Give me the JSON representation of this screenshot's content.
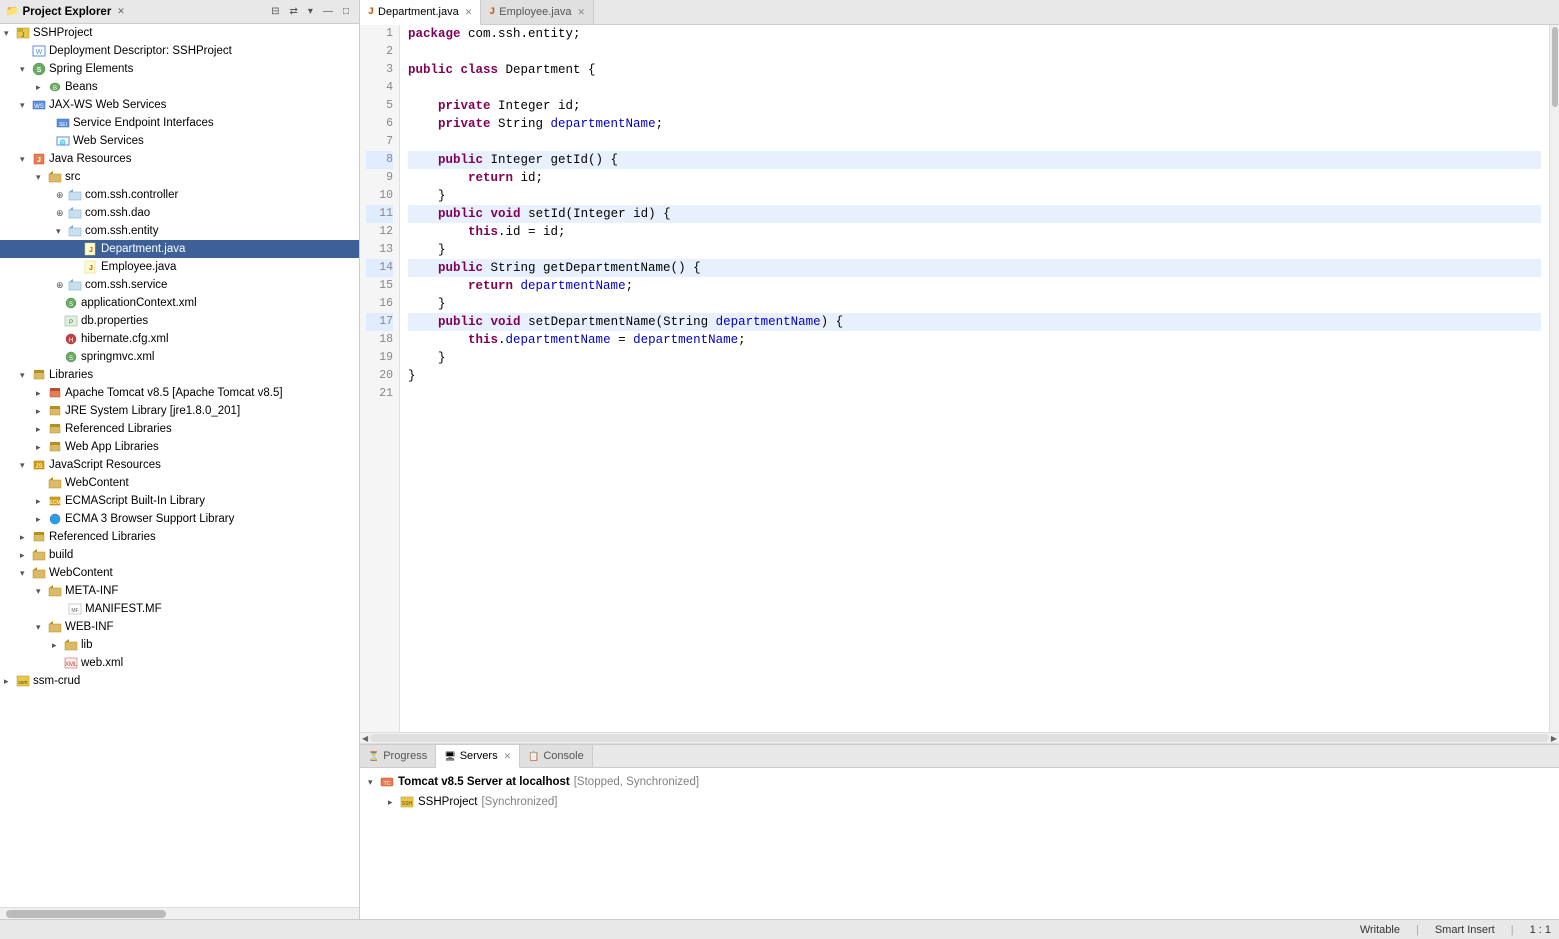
{
  "projectExplorer": {
    "title": "Project Explorer",
    "tree": [
      {
        "id": "sshproject",
        "label": "SSHProject",
        "indent": 0,
        "type": "project",
        "open": true,
        "arrow": "open"
      },
      {
        "id": "deploy-desc",
        "label": "Deployment Descriptor: SSHProject",
        "indent": 1,
        "type": "descriptor",
        "arrow": "leaf"
      },
      {
        "id": "spring-elements",
        "label": "Spring Elements",
        "indent": 1,
        "type": "spring",
        "open": true,
        "arrow": "open"
      },
      {
        "id": "beans",
        "label": "Beans",
        "indent": 2,
        "type": "beans",
        "arrow": "closed"
      },
      {
        "id": "jax-ws",
        "label": "JAX-WS Web Services",
        "indent": 1,
        "type": "webservices",
        "open": true,
        "arrow": "open"
      },
      {
        "id": "sei",
        "label": "Service Endpoint Interfaces",
        "indent": 2,
        "type": "interface",
        "arrow": "leaf"
      },
      {
        "id": "web-services",
        "label": "Web Services",
        "indent": 2,
        "type": "web",
        "arrow": "leaf"
      },
      {
        "id": "java-resources",
        "label": "Java Resources",
        "indent": 1,
        "type": "java",
        "open": true,
        "arrow": "open"
      },
      {
        "id": "src",
        "label": "src",
        "indent": 2,
        "type": "folder-src",
        "open": true,
        "arrow": "open"
      },
      {
        "id": "pkg-controller",
        "label": "com.ssh.controller",
        "indent": 3,
        "type": "package",
        "arrow": "closed"
      },
      {
        "id": "pkg-dao",
        "label": "com.ssh.dao",
        "indent": 3,
        "type": "package",
        "arrow": "closed"
      },
      {
        "id": "pkg-entity",
        "label": "com.ssh.entity",
        "indent": 3,
        "type": "package",
        "open": true,
        "arrow": "open"
      },
      {
        "id": "dept-java",
        "label": "Department.java",
        "indent": 4,
        "type": "java-file",
        "selected": true,
        "arrow": "leaf"
      },
      {
        "id": "emp-java",
        "label": "Employee.java",
        "indent": 4,
        "type": "java-file",
        "arrow": "leaf"
      },
      {
        "id": "pkg-service",
        "label": "com.ssh.service",
        "indent": 3,
        "type": "package",
        "arrow": "closed"
      },
      {
        "id": "app-context",
        "label": "applicationContext.xml",
        "indent": 3,
        "type": "xml-spring",
        "arrow": "leaf"
      },
      {
        "id": "db-props",
        "label": "db.properties",
        "indent": 3,
        "type": "properties",
        "arrow": "leaf"
      },
      {
        "id": "hibernate-cfg",
        "label": "hibernate.cfg.xml",
        "indent": 3,
        "type": "xml-hibernate",
        "arrow": "leaf"
      },
      {
        "id": "springmvc-xml",
        "label": "springmvc.xml",
        "indent": 3,
        "type": "xml-spring",
        "arrow": "leaf"
      },
      {
        "id": "libraries",
        "label": "Libraries",
        "indent": 1,
        "type": "libraries",
        "open": true,
        "arrow": "open"
      },
      {
        "id": "tomcat-lib",
        "label": "Apache Tomcat v8.5 [Apache Tomcat v8.5]",
        "indent": 2,
        "type": "server-lib",
        "arrow": "closed"
      },
      {
        "id": "jre-lib",
        "label": "JRE System Library [jre1.8.0_201]",
        "indent": 2,
        "type": "jre-lib",
        "arrow": "closed"
      },
      {
        "id": "ref-libs",
        "label": "Referenced Libraries",
        "indent": 2,
        "type": "lib",
        "arrow": "closed"
      },
      {
        "id": "webapp-libs",
        "label": "Web App Libraries",
        "indent": 2,
        "type": "lib",
        "arrow": "closed"
      },
      {
        "id": "js-resources",
        "label": "JavaScript Resources",
        "indent": 1,
        "type": "js-resources",
        "open": true,
        "arrow": "open"
      },
      {
        "id": "webcontent",
        "label": "WebContent",
        "indent": 2,
        "type": "folder",
        "arrow": "leaf"
      },
      {
        "id": "ecmascript-builtin",
        "label": "ECMAScript Built-In Library",
        "indent": 2,
        "type": "js-lib",
        "arrow": "closed"
      },
      {
        "id": "ecma3",
        "label": "ECMA 3 Browser Support Library",
        "indent": 2,
        "type": "js-lib",
        "arrow": "closed"
      },
      {
        "id": "ref-libs2",
        "label": "Referenced Libraries",
        "indent": 1,
        "type": "lib",
        "arrow": "closed"
      },
      {
        "id": "build",
        "label": "build",
        "indent": 1,
        "type": "folder",
        "arrow": "closed"
      },
      {
        "id": "webcontent2",
        "label": "WebContent",
        "indent": 1,
        "type": "folder",
        "open": true,
        "arrow": "open"
      },
      {
        "id": "meta-inf",
        "label": "META-INF",
        "indent": 2,
        "type": "folder",
        "open": true,
        "arrow": "open"
      },
      {
        "id": "manifest",
        "label": "MANIFEST.MF",
        "indent": 3,
        "type": "manifest",
        "arrow": "leaf"
      },
      {
        "id": "web-inf",
        "label": "WEB-INF",
        "indent": 2,
        "type": "folder",
        "open": true,
        "arrow": "open"
      },
      {
        "id": "lib",
        "label": "lib",
        "indent": 3,
        "type": "folder",
        "arrow": "closed"
      },
      {
        "id": "web-xml",
        "label": "web.xml",
        "indent": 3,
        "type": "xml-web",
        "arrow": "leaf"
      },
      {
        "id": "ssm-crud",
        "label": "ssm-crud",
        "indent": 0,
        "type": "project",
        "arrow": "closed"
      }
    ]
  },
  "editor": {
    "tabs": [
      {
        "id": "dept",
        "label": "Department.java",
        "icon": "J",
        "active": true
      },
      {
        "id": "emp",
        "label": "Employee.java",
        "icon": "J",
        "active": false
      }
    ],
    "filename": "Department.java",
    "lines": [
      {
        "num": 1,
        "code": "<span class='kw'>package</span> com.ssh.entity;"
      },
      {
        "num": 2,
        "code": ""
      },
      {
        "num": 3,
        "code": "<span class='kw'>public</span> <span class='kw'>class</span> Department {"
      },
      {
        "num": 4,
        "code": ""
      },
      {
        "num": 5,
        "code": "    <span class='kw'>private</span> Integer id;"
      },
      {
        "num": 6,
        "code": "    <span class='kw'>private</span> String <span class='field'>departmentName</span>;"
      },
      {
        "num": 7,
        "code": ""
      },
      {
        "num": 8,
        "code": "    <span class='kw'>public</span> Integer <span class='method'>getId</span>() {"
      },
      {
        "num": 9,
        "code": "        <span class='kw'>return</span> id;"
      },
      {
        "num": 10,
        "code": "    }"
      },
      {
        "num": 11,
        "code": "    <span class='kw'>public</span> <span class='kw'>void</span> <span class='method'>setId</span>(Integer id) {"
      },
      {
        "num": 12,
        "code": "        <span class='kw'>this</span>.id = id;"
      },
      {
        "num": 13,
        "code": "    }"
      },
      {
        "num": 14,
        "code": "    <span class='kw'>public</span> String <span class='method'>getDepartmentName</span>() {"
      },
      {
        "num": 15,
        "code": "        <span class='kw'>return</span> <span class='field'>departmentName</span>;"
      },
      {
        "num": 16,
        "code": "    }"
      },
      {
        "num": 17,
        "code": "    <span class='kw'>public</span> <span class='kw'>void</span> <span class='method'>setDepartmentName</span>(String <span class='field'>departmentName</span>) {"
      },
      {
        "num": 18,
        "code": "        <span class='kw'>this</span>.<span class='field'>departmentName</span> = <span class='field'>departmentName</span>;"
      },
      {
        "num": 19,
        "code": "    }"
      },
      {
        "num": 20,
        "code": "}"
      },
      {
        "num": 21,
        "code": ""
      }
    ]
  },
  "bottomPanel": {
    "tabs": [
      {
        "id": "progress",
        "label": "Progress",
        "icon": "⏳",
        "active": false
      },
      {
        "id": "servers",
        "label": "Servers",
        "icon": "🖥",
        "active": true
      },
      {
        "id": "console",
        "label": "Console",
        "icon": "📋",
        "active": false
      }
    ],
    "servers": [
      {
        "label": "Tomcat v8.5 Server at localhost",
        "status": "[Stopped, Synchronized]",
        "open": true,
        "children": [
          {
            "label": "SSHProject",
            "status": "[Synchronized]"
          }
        ]
      }
    ]
  },
  "statusBar": {
    "writable": "Writable",
    "insertMode": "Smart Insert",
    "position": "1 : 1"
  }
}
